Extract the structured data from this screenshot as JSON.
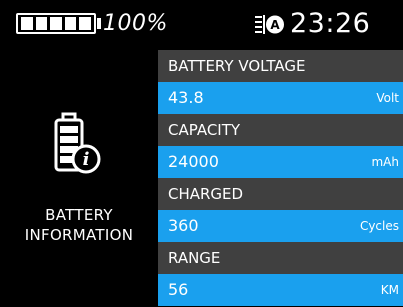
{
  "status_bar": {
    "battery_percent_text": "100%",
    "battery_level": 1.0,
    "status_icon": "auto-headlight-icon",
    "time": "23:26"
  },
  "panel": {
    "icon": "battery-info-icon",
    "title_line1": "BATTERY",
    "title_line2": "INFORMATION"
  },
  "items": [
    {
      "label": "BATTERY VOLTAGE",
      "value": "43.8",
      "unit": "Volt"
    },
    {
      "label": "CAPACITY",
      "value": "24000",
      "unit": "mAh"
    },
    {
      "label": "CHARGED",
      "value": "360",
      "unit": "Cycles"
    },
    {
      "label": "RANGE",
      "value": "56",
      "unit": "KM"
    }
  ],
  "colors": {
    "background": "#000000",
    "label_row": "#404040",
    "value_row": "#1aa0ee",
    "text": "#ffffff"
  }
}
